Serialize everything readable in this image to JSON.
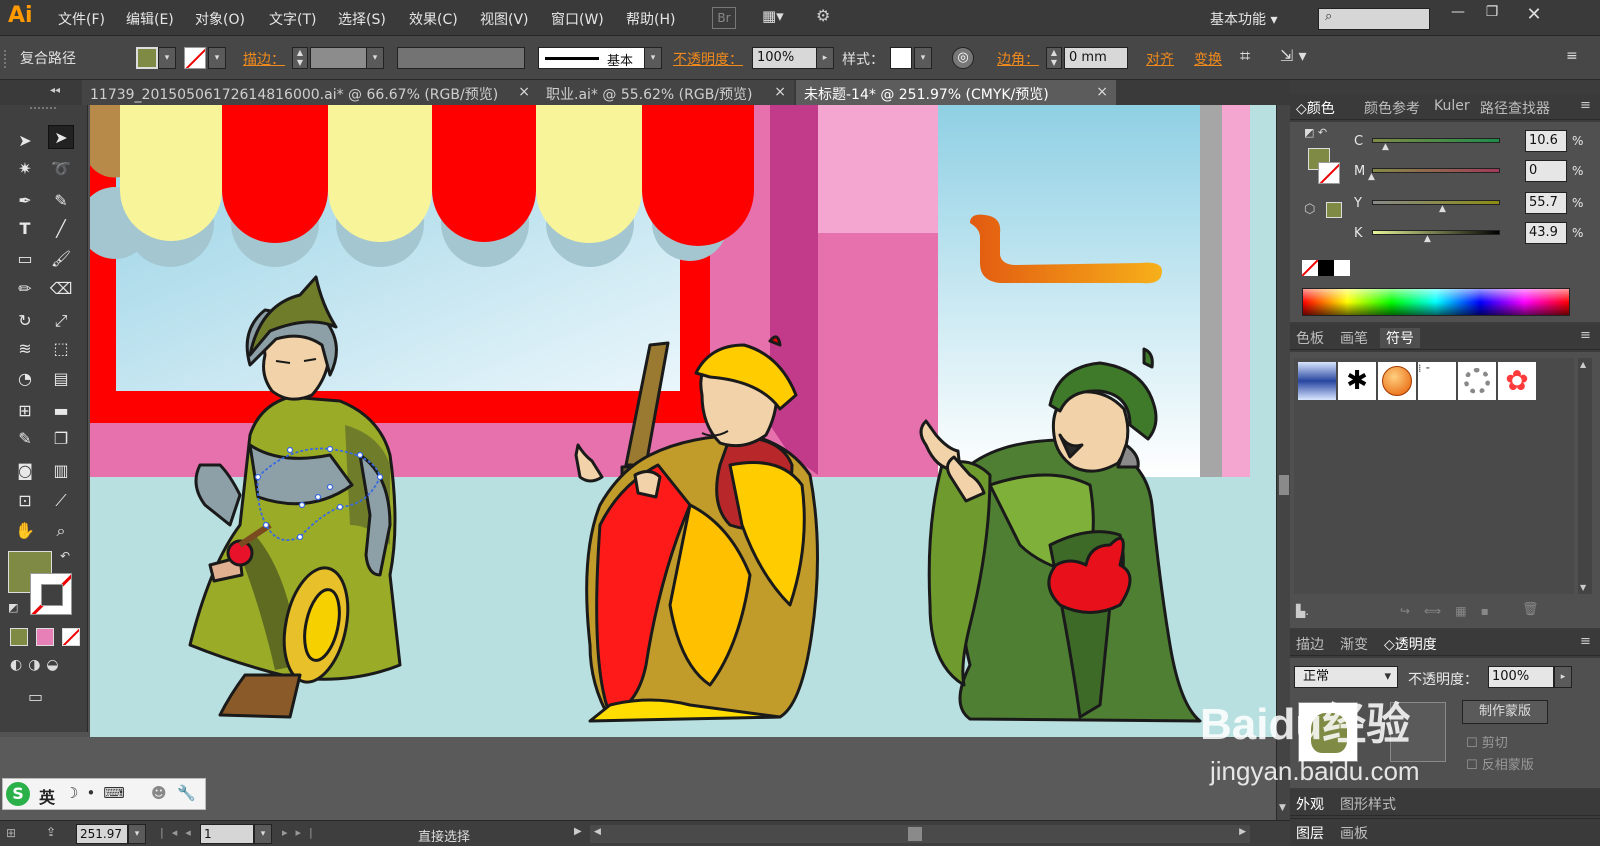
{
  "app": {
    "logo": "Ai"
  },
  "menu": [
    "文件(F)",
    "编辑(E)",
    "对象(O)",
    "文字(T)",
    "选择(S)",
    "效果(C)",
    "视图(V)",
    "窗口(W)",
    "帮助(H)"
  ],
  "bridge_label": "Br",
  "workspace": "基本功能",
  "search_placeholder": "",
  "control": {
    "selection_type": "复合路径",
    "stroke_label": "描边：",
    "stroke_style": "基本",
    "opacity_label": "不透明度：",
    "opacity_value": "100%",
    "style_label": "样式：",
    "corner_label": "边角：",
    "corner_value": "0 mm",
    "align_label": "对齐",
    "transform_label": "变换"
  },
  "tabs": [
    {
      "label": "11739_20150506172614816000.ai* @ 66.67% (RGB/预览)",
      "close": "×"
    },
    {
      "label": "职业.ai* @ 55.62% (RGB/预览)",
      "close": "×"
    },
    {
      "label": "未标题-14* @ 251.97% (CMYK/预览)",
      "close": "×"
    }
  ],
  "colors": {
    "fill": "#7f8b45",
    "accent_orange": "#f08a1c"
  },
  "color_panel": {
    "tabs": [
      "颜色",
      "颜色参考",
      "Kuler",
      "路径查找器"
    ],
    "channels": [
      {
        "label": "C",
        "value": "10.6",
        "unit": "%",
        "level": 0.106
      },
      {
        "label": "M",
        "value": "0",
        "unit": "%",
        "level": 0.0
      },
      {
        "label": "Y",
        "value": "55.7",
        "unit": "%",
        "level": 0.557
      },
      {
        "label": "K",
        "value": "43.9",
        "unit": "%",
        "level": 0.439
      }
    ]
  },
  "symbols_panel": {
    "tabs": [
      "色板",
      "画笔",
      "符号"
    ]
  },
  "transparency_panel": {
    "tabs": [
      "描边",
      "渐变",
      "透明度"
    ],
    "blend_mode": "正常",
    "opacity_label": "不透明度：",
    "opacity_value": "100%",
    "make_mask": "制作蒙版",
    "clip": "剪切",
    "invert_mask": "反相蒙版"
  },
  "appearance_panel": {
    "tabs": [
      "外观",
      "图形样式"
    ]
  },
  "layers_panel": {
    "tabs": [
      "图层",
      "画板"
    ]
  },
  "status": {
    "zoom": "251.97",
    "artboard": "1",
    "tool_name": "直接选择"
  },
  "ime": {
    "mode": "英"
  },
  "watermark": {
    "brand": "Baidu经验",
    "url": "jingyan.baidu.com"
  }
}
